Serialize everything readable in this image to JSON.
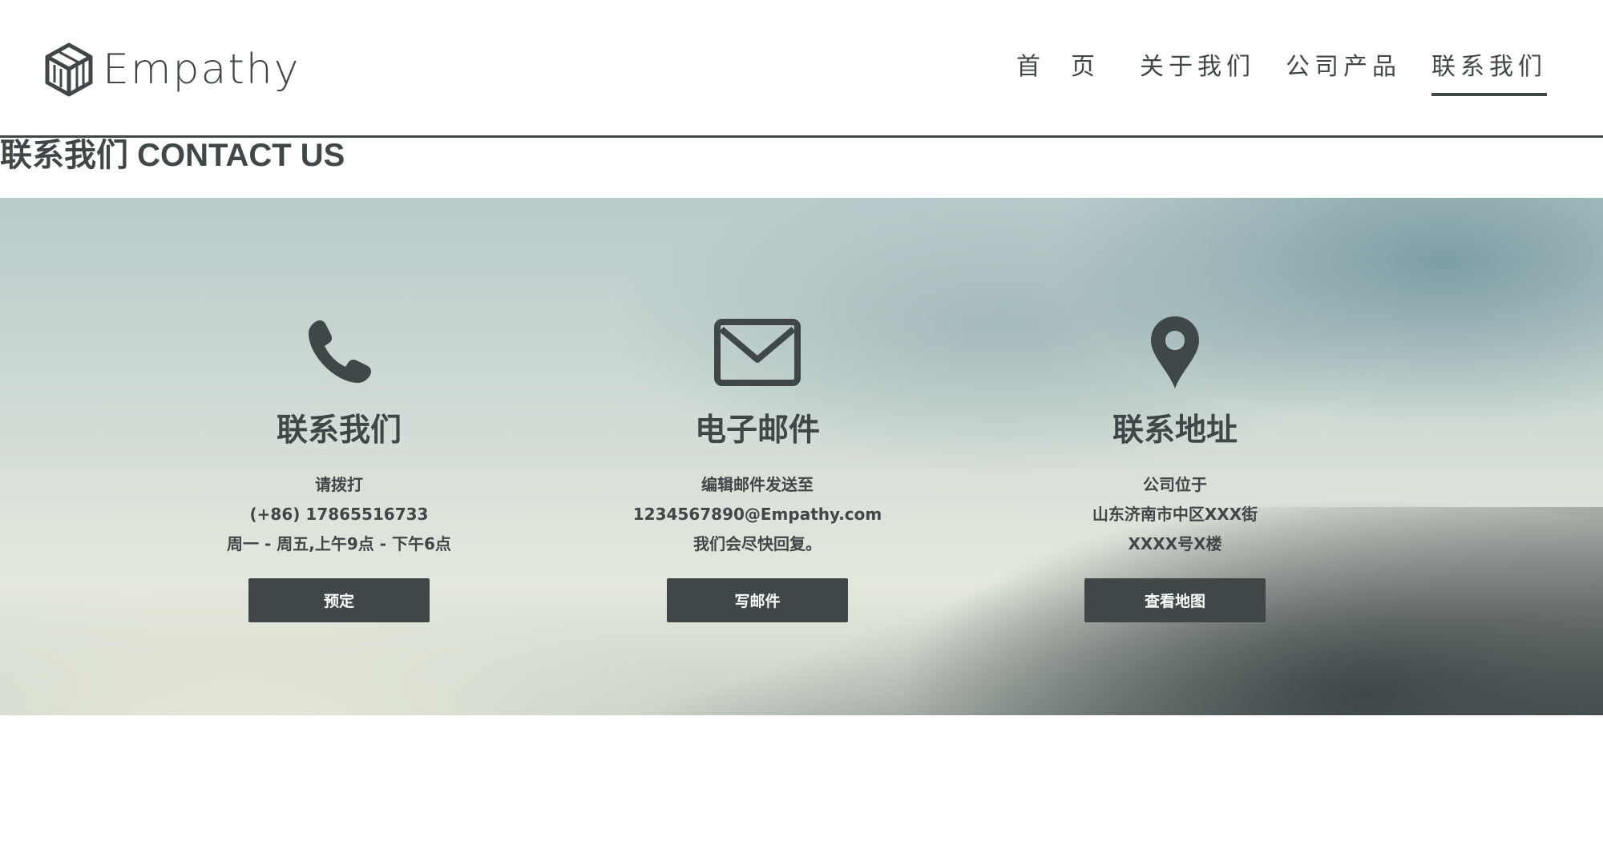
{
  "header": {
    "logo_text": "Empathy",
    "logo_icon": "isometric-cube-logo",
    "nav": [
      {
        "label": "首页",
        "active": false
      },
      {
        "label": "关于我们",
        "active": false
      },
      {
        "label": "公司产品",
        "active": false
      },
      {
        "label": "联系我们",
        "active": true
      }
    ]
  },
  "section": {
    "title": "联系我们 CONTACT US"
  },
  "cards": [
    {
      "icon": "phone-icon",
      "title": "联系我们",
      "lines": [
        "请拨打",
        "(+86) 17865516733",
        "周一 - 周五,上午9点 - 下午6点"
      ],
      "button": "预定"
    },
    {
      "icon": "envelope-icon",
      "title": "电子邮件",
      "lines": [
        "编辑邮件发送至",
        "1234567890@Empathy.com",
        "我们会尽快回复。"
      ],
      "button": "写邮件"
    },
    {
      "icon": "map-pin-icon",
      "title": "联系地址",
      "lines": [
        "公司位于",
        "山东济南市中区XXX街",
        "XXXX号X楼"
      ],
      "button": "查看地图"
    }
  ],
  "colors": {
    "primary": "#3f4749",
    "background": "#ffffff",
    "button_text": "#ffffff"
  }
}
